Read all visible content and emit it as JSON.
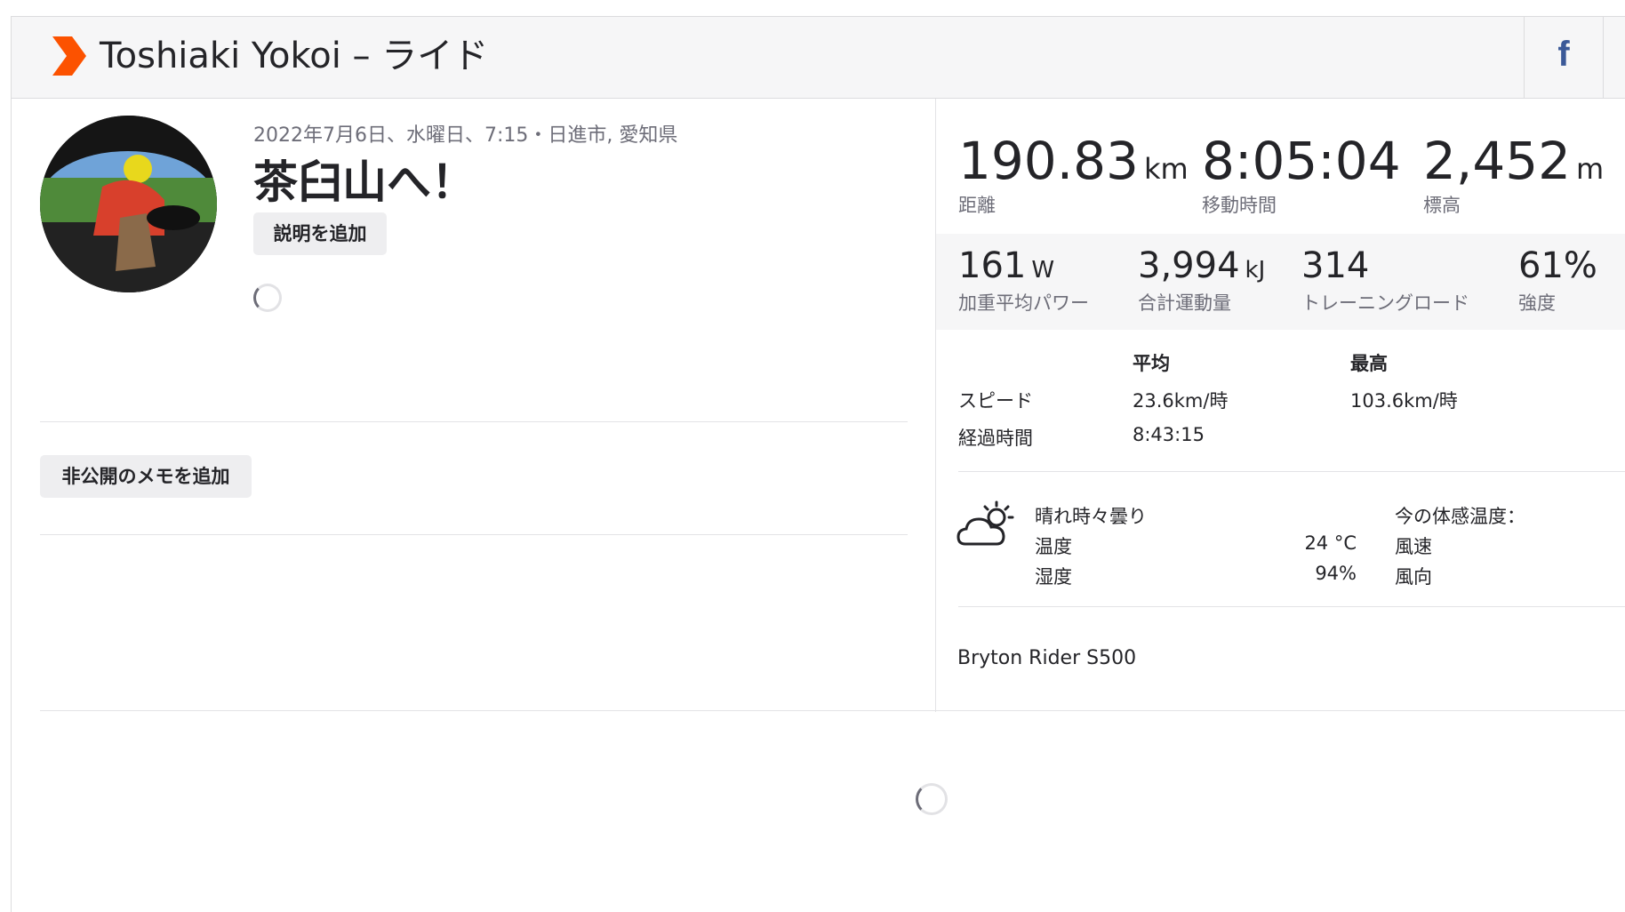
{
  "header": {
    "title": "Toshiaki Yokoi – ライド",
    "facebook_label": "f",
    "brand_color": "#fc5200",
    "facebook_color": "#3b5998"
  },
  "activity": {
    "meta": "2022年7月6日、水曜日、7:15・日進市, 愛知県",
    "name": "茶臼山へ！",
    "add_description_label": "説明を追加",
    "add_private_note_label": "非公開のメモを追加"
  },
  "primary_stats": [
    {
      "value": "190.83",
      "unit": "km",
      "label": "距離"
    },
    {
      "value": "8:05:04",
      "unit": "",
      "label": "移動時間"
    },
    {
      "value": "2,452",
      "unit": "m",
      "label": "標高"
    }
  ],
  "secondary_stats": [
    {
      "value": "161",
      "unit": "W",
      "label": "加重平均パワー"
    },
    {
      "value": "3,994",
      "unit": "kJ",
      "label": "合計運動量"
    },
    {
      "value": "314",
      "unit": "",
      "label": "トレーニングロード"
    },
    {
      "value": "61%",
      "unit": "",
      "label": "強度"
    }
  ],
  "more_stats": {
    "headers": {
      "avg": "平均",
      "max": "最高"
    },
    "rows": [
      {
        "label": "スピード",
        "avg": "23.6km/時",
        "max": "103.6km/時"
      },
      {
        "label": "経過時間",
        "avg": "8:43:15",
        "max": ""
      }
    ]
  },
  "weather": {
    "icon": "partly-sunny-cloud-icon",
    "condition": "晴れ時々曇り",
    "temp_label": "温度",
    "temp_value": "24 °C",
    "humidity_label": "湿度",
    "humidity_value": "94%",
    "feels_like_label": "今の体感温度：",
    "wind_speed_label": "風速",
    "wind_dir_label": "風向"
  },
  "device": "Bryton Rider S500"
}
